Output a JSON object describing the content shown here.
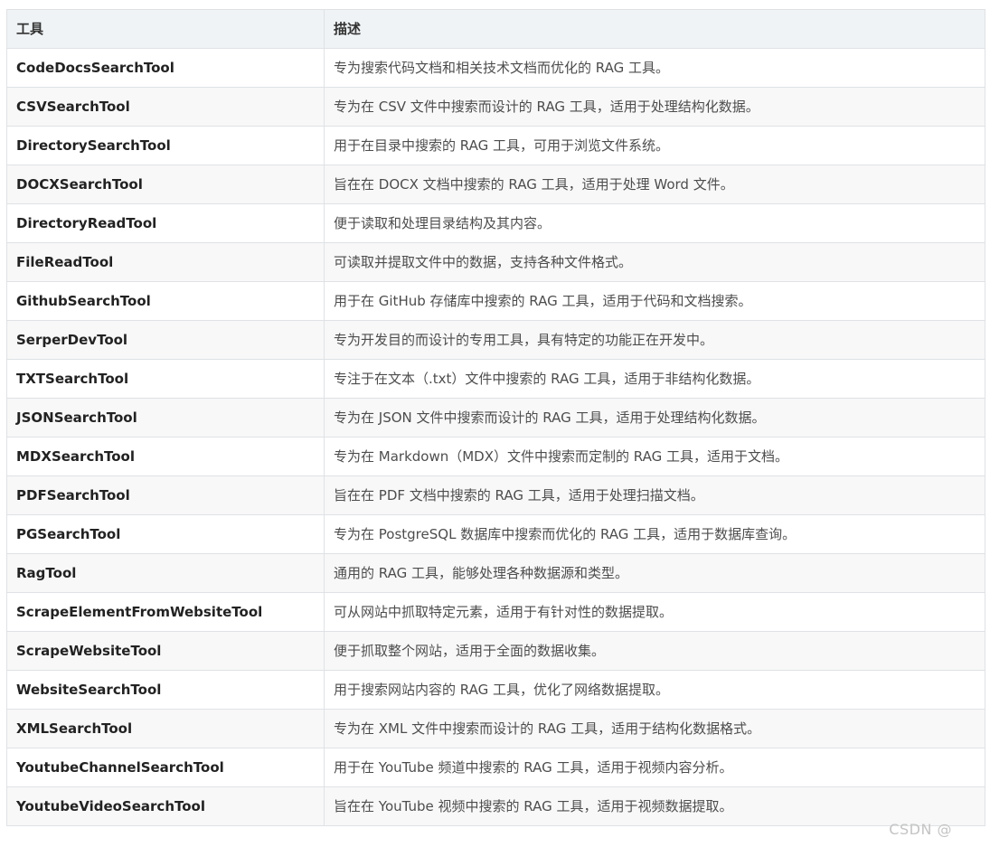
{
  "table": {
    "headers": [
      "工具",
      "描述"
    ],
    "rows": [
      [
        "CodeDocsSearchTool",
        "专为搜索代码文档和相关技术文档而优化的 RAG 工具。"
      ],
      [
        "CSVSearchTool",
        "专为在 CSV 文件中搜索而设计的 RAG 工具，适用于处理结构化数据。"
      ],
      [
        "DirectorySearchTool",
        "用于在目录中搜索的 RAG 工具，可用于浏览文件系统。"
      ],
      [
        "DOCXSearchTool",
        "旨在在 DOCX 文档中搜索的 RAG 工具，适用于处理 Word 文件。"
      ],
      [
        "DirectoryReadTool",
        "便于读取和处理目录结构及其内容。"
      ],
      [
        "FileReadTool",
        "可读取并提取文件中的数据，支持各种文件格式。"
      ],
      [
        "GithubSearchTool",
        "用于在 GitHub 存储库中搜索的 RAG 工具，适用于代码和文档搜索。"
      ],
      [
        "SerperDevTool",
        "专为开发目的而设计的专用工具，具有特定的功能正在开发中。"
      ],
      [
        "TXTSearchTool",
        "专注于在文本（.txt）文件中搜索的 RAG 工具，适用于非结构化数据。"
      ],
      [
        "JSONSearchTool",
        "专为在 JSON 文件中搜索而设计的 RAG 工具，适用于处理结构化数据。"
      ],
      [
        "MDXSearchTool",
        "专为在 Markdown（MDX）文件中搜索而定制的 RAG 工具，适用于文档。"
      ],
      [
        "PDFSearchTool",
        "旨在在 PDF 文档中搜索的 RAG 工具，适用于处理扫描文档。"
      ],
      [
        "PGSearchTool",
        "专为在 PostgreSQL 数据库中搜索而优化的 RAG 工具，适用于数据库查询。"
      ],
      [
        "RagTool",
        "通用的 RAG 工具，能够处理各种数据源和类型。"
      ],
      [
        "ScrapeElementFromWebsiteTool",
        "可从网站中抓取特定元素，适用于有针对性的数据提取。"
      ],
      [
        "ScrapeWebsiteTool",
        "便于抓取整个网站，适用于全面的数据收集。"
      ],
      [
        "WebsiteSearchTool",
        "用于搜索网站内容的 RAG 工具，优化了网络数据提取。"
      ],
      [
        "XMLSearchTool",
        "专为在 XML 文件中搜索而设计的 RAG 工具，适用于结构化数据格式。"
      ],
      [
        "YoutubeChannelSearchTool",
        "用于在 YouTube 频道中搜索的 RAG 工具，适用于视频内容分析。"
      ],
      [
        "YoutubeVideoSearchTool",
        "旨在在 YouTube 视频中搜索的 RAG 工具，适用于视频数据提取。"
      ]
    ]
  },
  "watermark": "CSDN @",
  "colors": {
    "header_bg": "#eff3f5",
    "row_alt_bg": "#f8f8f8",
    "border": "#dfe2e5",
    "watermark": "#c4c4c4"
  }
}
